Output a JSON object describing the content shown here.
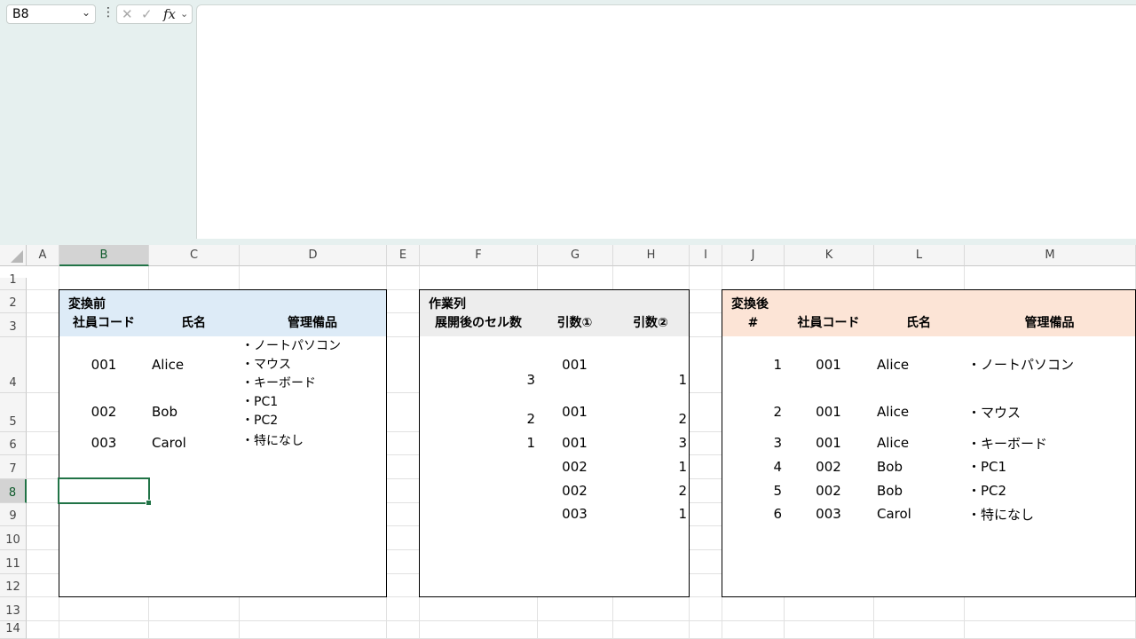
{
  "formula_bar": {
    "name_box": "B8",
    "formula": ""
  },
  "columns": [
    "A",
    "B",
    "C",
    "D",
    "E",
    "F",
    "G",
    "H",
    "I",
    "J",
    "K",
    "L",
    "M"
  ],
  "rows": [
    "1",
    "2",
    "3",
    "4",
    "5",
    "6",
    "7",
    "8",
    "9",
    "10",
    "11",
    "12",
    "13",
    "14"
  ],
  "selected": {
    "column": "B",
    "row": "8"
  },
  "table_before": {
    "title": "変換前",
    "headers": [
      "社員コード",
      "氏名",
      "管理備品"
    ],
    "rows": [
      {
        "code": "001",
        "name": "Alice",
        "items": [
          "・ノートパソコン",
          "・マウス",
          "・キーボード"
        ]
      },
      {
        "code": "002",
        "name": "Bob",
        "items": [
          "・PC1",
          "・PC2"
        ]
      },
      {
        "code": "003",
        "name": "Carol",
        "items": [
          "・特になし"
        ]
      }
    ]
  },
  "table_work": {
    "title": "作業列",
    "headers": [
      "展開後のセル数",
      "引数①",
      "引数②"
    ],
    "rows": [
      [
        "3",
        "001",
        "1"
      ],
      [
        "2",
        "001",
        "2"
      ],
      [
        "1",
        "001",
        "3"
      ],
      [
        "",
        "002",
        "1"
      ],
      [
        "",
        "002",
        "2"
      ],
      [
        "",
        "003",
        "1"
      ]
    ]
  },
  "table_after": {
    "title": "変換後",
    "headers": [
      "#",
      "社員コード",
      "氏名",
      "管理備品"
    ],
    "rows": [
      [
        "1",
        "001",
        "Alice",
        "・ノートパソコン"
      ],
      [
        "2",
        "001",
        "Alice",
        "・マウス"
      ],
      [
        "3",
        "001",
        "Alice",
        "・キーボード"
      ],
      [
        "4",
        "002",
        "Bob",
        "・PC1"
      ],
      [
        "5",
        "002",
        "Bob",
        "・PC2"
      ],
      [
        "6",
        "003",
        "Carol",
        "・特になし"
      ]
    ]
  },
  "colors": {
    "before_header": "#ddebf7",
    "work_header": "#ededed",
    "after_header": "#fce4d6",
    "selection": "#217346"
  }
}
